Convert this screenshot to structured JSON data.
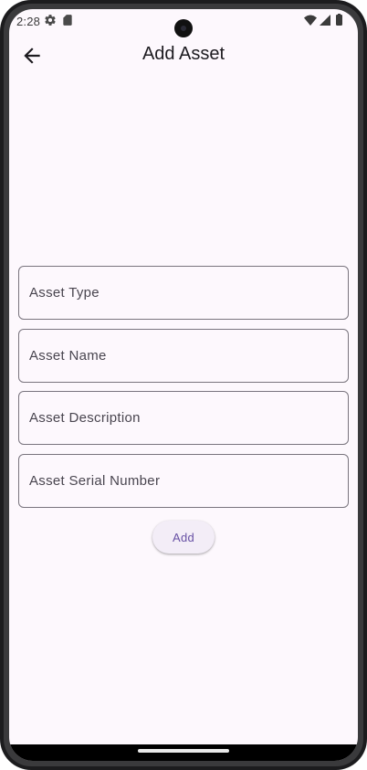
{
  "status_bar": {
    "time": "2:28",
    "icons": [
      "settings-icon",
      "sd-card-icon",
      "wifi-icon",
      "cellular-signal-icon",
      "battery-icon"
    ]
  },
  "app_bar": {
    "title": "Add Asset",
    "back_icon": "arrow-back-icon"
  },
  "form": {
    "fields": [
      {
        "label": "Asset Type",
        "value": ""
      },
      {
        "label": "Asset Name",
        "value": ""
      },
      {
        "label": "Asset Description",
        "value": ""
      },
      {
        "label": "Asset Serial Number",
        "value": ""
      }
    ],
    "submit_label": "Add"
  },
  "colors": {
    "background": "#fdf8fd",
    "field_border": "#79747e",
    "button_text": "#6750a4",
    "button_bg": "#f3edf7"
  }
}
